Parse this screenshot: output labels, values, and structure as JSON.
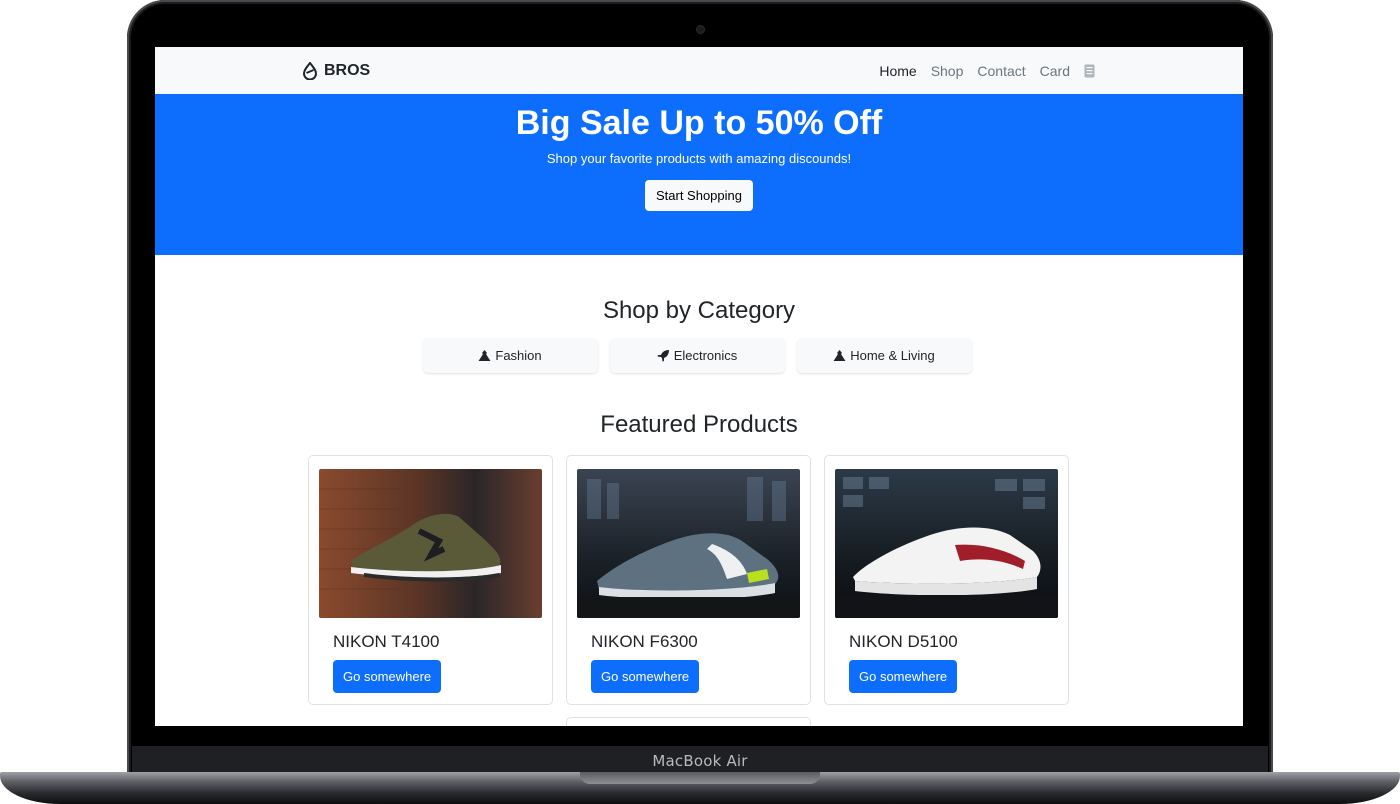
{
  "device": {
    "label": "MacBook Air"
  },
  "navbar": {
    "brand": "BROS",
    "links": [
      "Home",
      "Shop",
      "Contact",
      "Card"
    ]
  },
  "hero": {
    "title": "Big Sale Up to 50% Off",
    "subtitle": "Shop your favorite products with amazing discounds!",
    "cta": "Start Shopping"
  },
  "categories": {
    "title": "Shop by Category",
    "items": [
      {
        "label": "Fashion",
        "icon": "tshirt-icon"
      },
      {
        "label": "Electronics",
        "icon": "rocket-icon"
      },
      {
        "label": "Home & Living",
        "icon": "tshirt-icon"
      }
    ]
  },
  "featured": {
    "title": "Featured Products",
    "products": [
      {
        "name": "NIKON T4100",
        "button": "Go somewhere",
        "image": "olive green sneaker photo"
      },
      {
        "name": "NIKON F6300",
        "button": "Go somewhere",
        "image": "grey and lime sneaker photo"
      },
      {
        "name": "NIKON D5100",
        "button": "Go somewhere",
        "image": "white and red sneaker photo"
      }
    ]
  },
  "colors": {
    "primary": "#0d6efd",
    "navbar_bg": "#f8f9fa",
    "text": "#212529"
  }
}
